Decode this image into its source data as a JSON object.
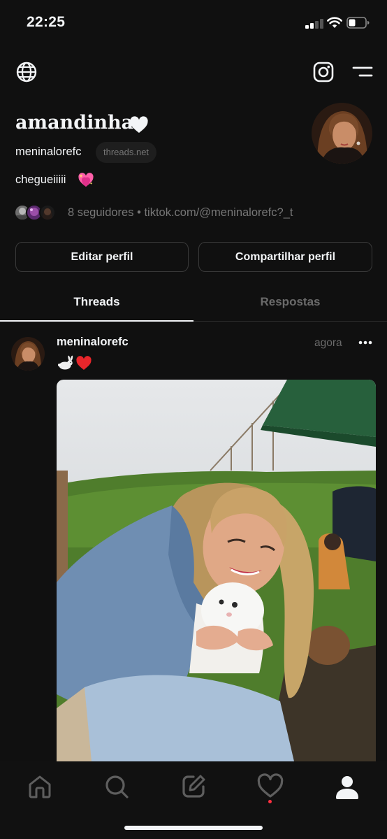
{
  "status_bar": {
    "time": "22:25"
  },
  "profile": {
    "display_name": "amandinha",
    "username": "meninalorefc",
    "domain_badge": "threads.net",
    "bio": "chegueiiiii",
    "followers_text": "8 seguidores",
    "separator": "•",
    "link_text": "tiktok.com/@meninalorefc?_t"
  },
  "actions": {
    "edit_label": "Editar perfil",
    "share_label": "Compartilhar perfil"
  },
  "tabs": [
    {
      "label": "Threads",
      "active": true
    },
    {
      "label": "Respostas",
      "active": false
    }
  ],
  "post": {
    "username": "meninalorefc",
    "time": "agora",
    "text_emoji": [
      "rabbit-emoji",
      "red-heart-emoji"
    ],
    "image": "photo-woman-holding-white-rabbit"
  },
  "bottom_nav": [
    {
      "icon": "home-icon",
      "active": false
    },
    {
      "icon": "search-icon",
      "active": false
    },
    {
      "icon": "compose-icon",
      "active": false
    },
    {
      "icon": "heart-icon",
      "active": false,
      "badge": true
    },
    {
      "icon": "profile-icon",
      "active": true
    }
  ],
  "colors": {
    "background": "#101010",
    "primary_text": "#f3f5f7",
    "secondary_text": "#777777",
    "border": "#3a3a3a",
    "notification": "#ff3040"
  }
}
